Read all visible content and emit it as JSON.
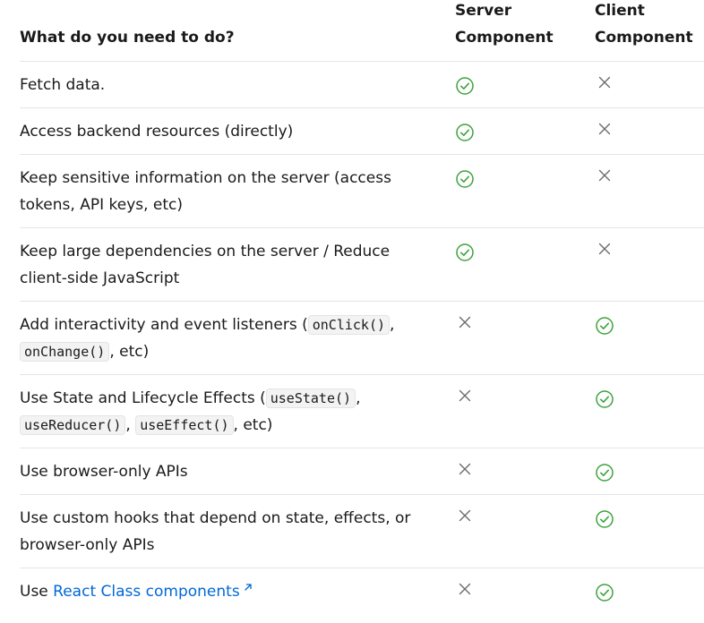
{
  "header": {
    "question": "What do you need to do?",
    "server_label": "Server Component",
    "client_label": "Client Component"
  },
  "rows": [
    {
      "text": "Fetch data.",
      "server": "check",
      "client": "cross"
    },
    {
      "text": "Access backend resources (directly)",
      "server": "check",
      "client": "cross"
    },
    {
      "text": "Keep sensitive information on the server (access tokens, API keys, etc)",
      "server": "check",
      "client": "cross"
    },
    {
      "text": "Keep large dependencies on the server / Reduce client-side JavaScript",
      "server": "check",
      "client": "cross"
    },
    {
      "parts": [
        {
          "t": "Add interactivity and event listeners ("
        },
        {
          "code": "onClick()"
        },
        {
          "t": ", "
        },
        {
          "code": "onChange()"
        },
        {
          "t": ", etc)"
        }
      ],
      "server": "cross",
      "client": "check"
    },
    {
      "parts": [
        {
          "t": "Use State and Lifecycle Effects ("
        },
        {
          "code": "useState()"
        },
        {
          "t": ", "
        },
        {
          "code": "useReducer()"
        },
        {
          "t": ", "
        },
        {
          "code": "useEffect()"
        },
        {
          "t": ", etc)"
        }
      ],
      "server": "cross",
      "client": "check"
    },
    {
      "text": "Use browser-only APIs",
      "server": "cross",
      "client": "check"
    },
    {
      "text": "Use custom hooks that depend on state, effects, or browser-only APIs",
      "server": "cross",
      "client": "check"
    },
    {
      "parts": [
        {
          "t": "Use "
        },
        {
          "link": "React Class components"
        }
      ],
      "server": "cross",
      "client": "check"
    }
  ],
  "icons": {
    "check": "check-circle-icon",
    "cross": "x-icon",
    "external": "external-link-icon"
  },
  "colors": {
    "check": "#3da33d",
    "cross": "#6b6b6b",
    "link": "#0068d6",
    "border": "#e5e5e5"
  }
}
